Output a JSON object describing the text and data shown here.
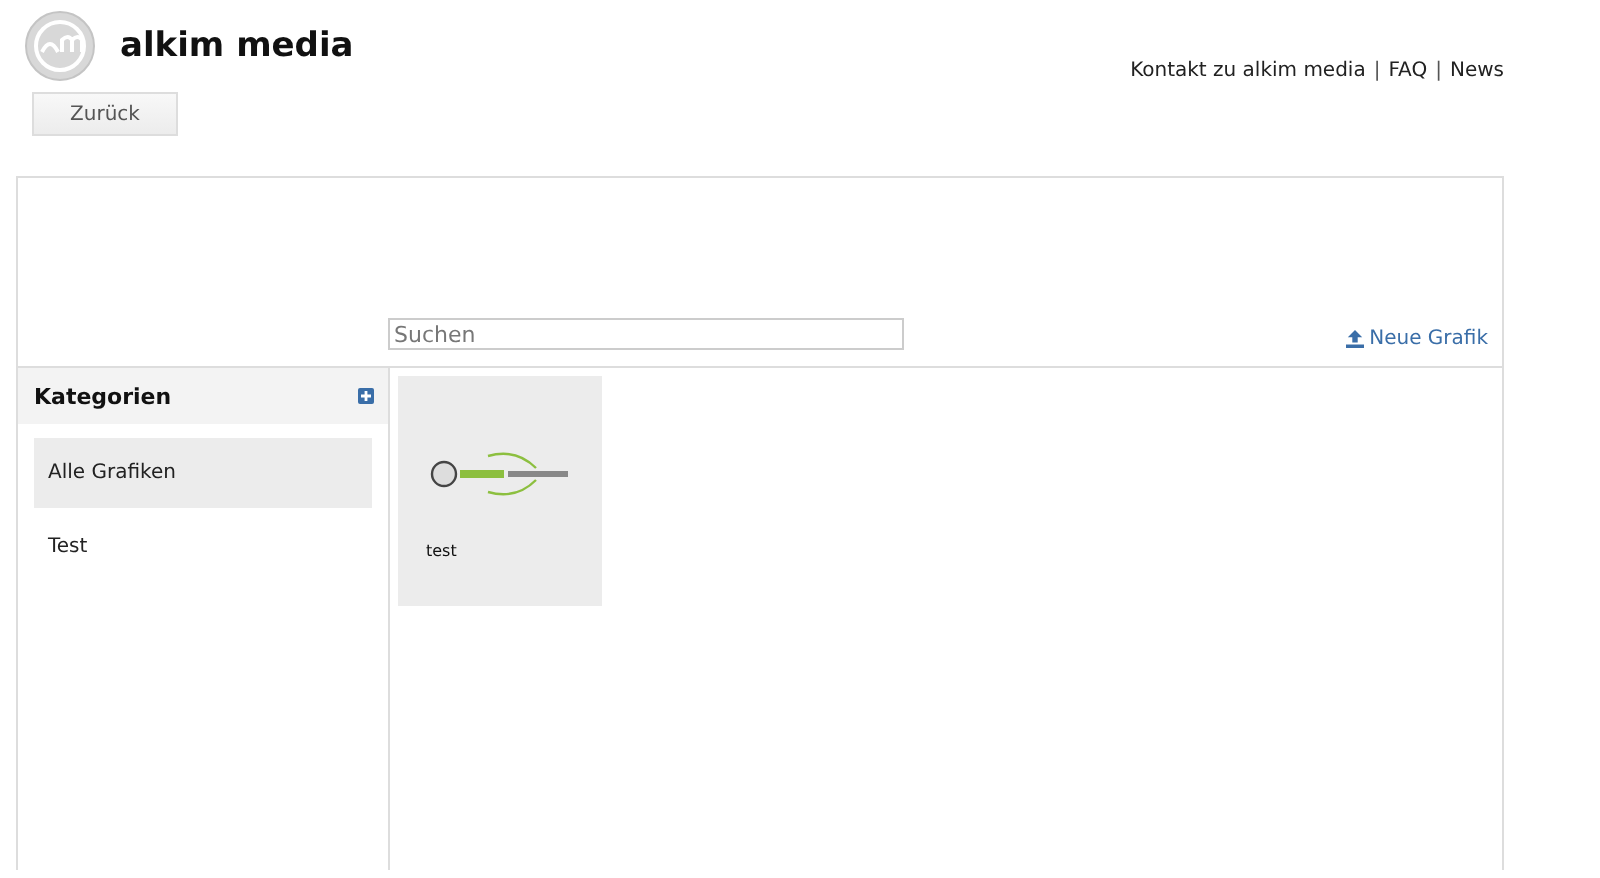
{
  "header": {
    "title": "alkim media",
    "back_button": "Zurück",
    "links": [
      "Kontakt zu alkim media",
      "FAQ",
      "News"
    ],
    "separators": [
      "|",
      "|"
    ]
  },
  "toolbar": {
    "search": {
      "placeholder": "Suchen"
    },
    "new_button": "Neue Grafik"
  },
  "sidebar": {
    "title": "Kategorien",
    "items": [
      {
        "label": "Alle Grafiken",
        "selected": true
      },
      {
        "label": "Test",
        "selected": false
      }
    ]
  },
  "gallery": [
    {
      "caption": "test"
    }
  ]
}
